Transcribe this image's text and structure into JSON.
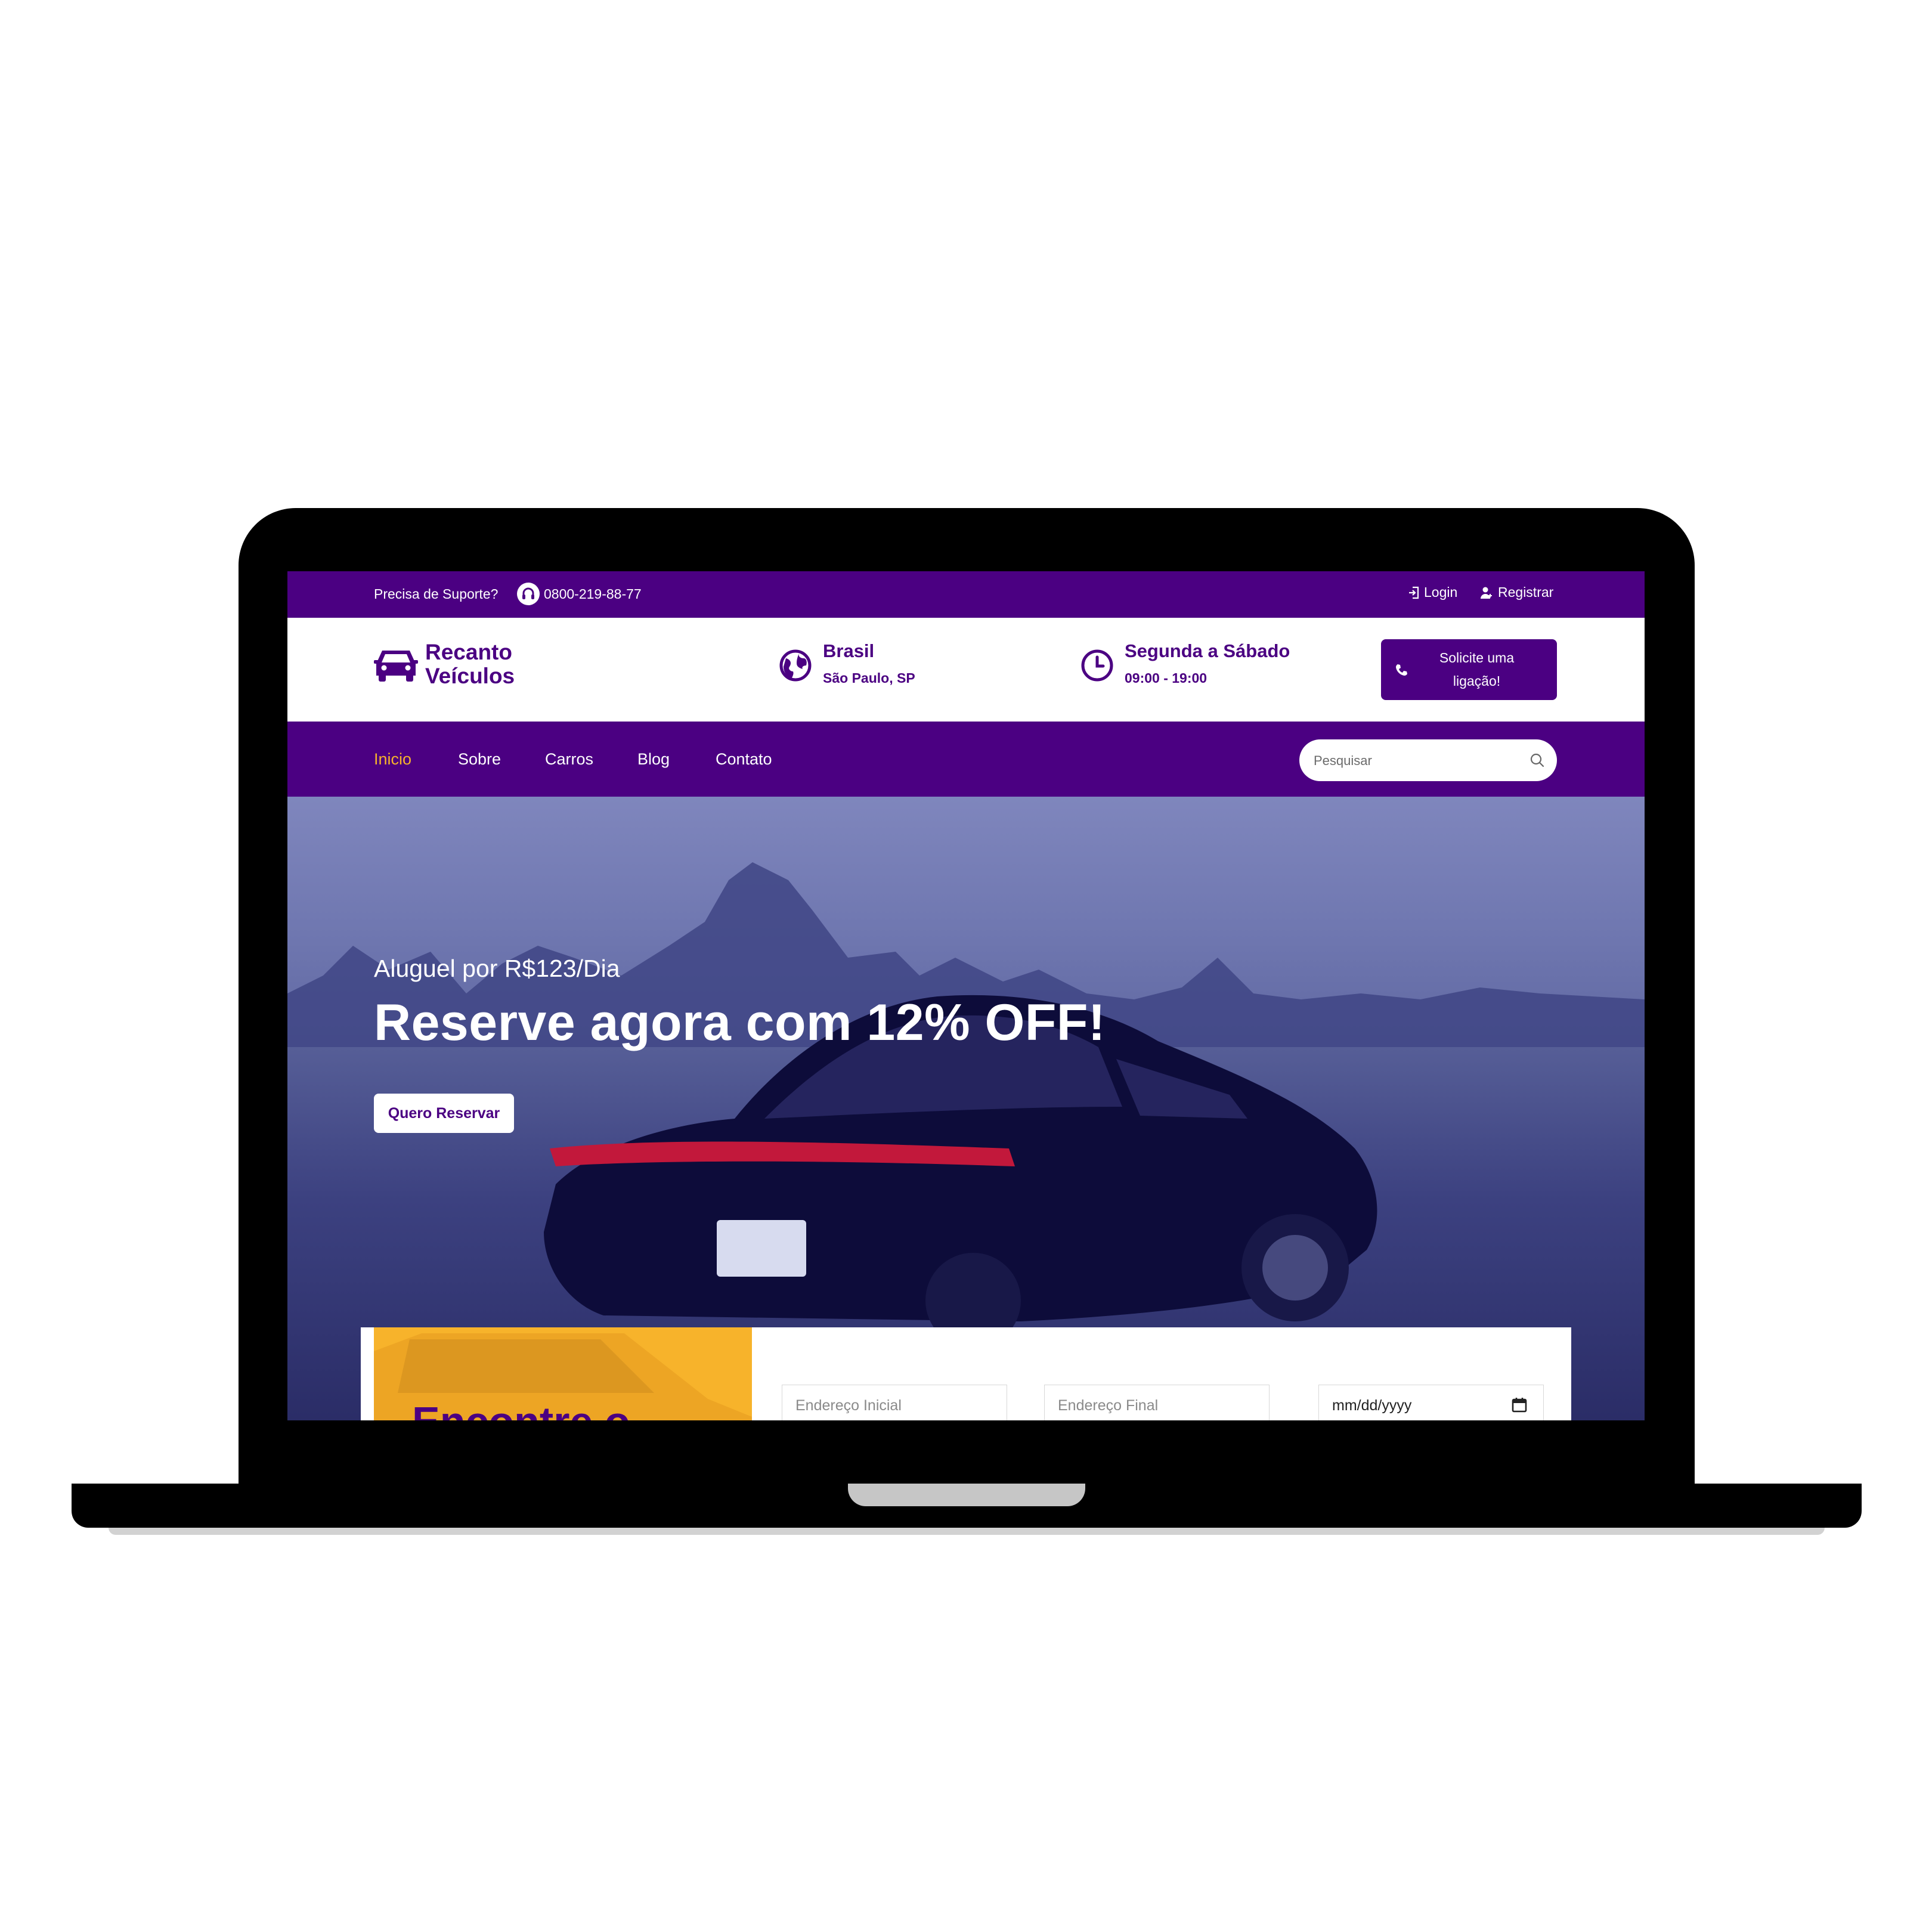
{
  "topbar": {
    "support_label": "Precisa de Suporte?",
    "phone": "0800-219-88-77",
    "login": "Login",
    "register": "Registrar"
  },
  "header": {
    "logo_line1": "Recanto",
    "logo_line2": "Veículos",
    "location_title": "Brasil",
    "location_sub": "São Paulo, SP",
    "hours_title": "Segunda a Sábado",
    "hours_sub": "09:00 - 19:00",
    "call_line1": "Solicite uma",
    "call_line2": "ligação!"
  },
  "nav": {
    "items": [
      "Inicio",
      "Sobre",
      "Carros",
      "Blog",
      "Contato"
    ],
    "active": "Inicio",
    "search_placeholder": "Pesquisar"
  },
  "hero": {
    "subtitle": "Aluguel por R$123/Dia",
    "title": "Reserve agora com 12% OFF!",
    "button": "Quero Reservar"
  },
  "booking": {
    "promo_title": "Encontre o",
    "start_placeholder": "Endereço Inicial",
    "end_placeholder": "Endereço Final",
    "date_value": "mm/dd/yyyy"
  },
  "colors": {
    "brand": "#4b0082",
    "accent": "#f7b32b",
    "white": "#ffffff"
  },
  "icons": [
    "headset-icon",
    "login-icon",
    "user-plus-icon",
    "car-icon",
    "globe-icon",
    "clock-icon",
    "phone-icon",
    "search-icon",
    "calendar-icon"
  ]
}
